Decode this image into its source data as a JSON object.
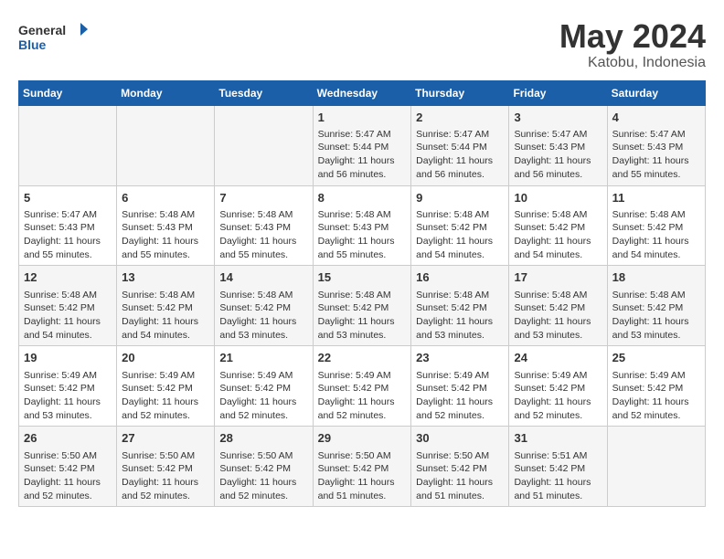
{
  "header": {
    "logo_line1": "General",
    "logo_line2": "Blue",
    "month": "May 2024",
    "location": "Katobu, Indonesia"
  },
  "weekdays": [
    "Sunday",
    "Monday",
    "Tuesday",
    "Wednesday",
    "Thursday",
    "Friday",
    "Saturday"
  ],
  "weeks": [
    [
      {
        "day": "",
        "info": ""
      },
      {
        "day": "",
        "info": ""
      },
      {
        "day": "",
        "info": ""
      },
      {
        "day": "1",
        "info": "Sunrise: 5:47 AM\nSunset: 5:44 PM\nDaylight: 11 hours and 56 minutes."
      },
      {
        "day": "2",
        "info": "Sunrise: 5:47 AM\nSunset: 5:44 PM\nDaylight: 11 hours and 56 minutes."
      },
      {
        "day": "3",
        "info": "Sunrise: 5:47 AM\nSunset: 5:43 PM\nDaylight: 11 hours and 56 minutes."
      },
      {
        "day": "4",
        "info": "Sunrise: 5:47 AM\nSunset: 5:43 PM\nDaylight: 11 hours and 55 minutes."
      }
    ],
    [
      {
        "day": "5",
        "info": "Sunrise: 5:47 AM\nSunset: 5:43 PM\nDaylight: 11 hours and 55 minutes."
      },
      {
        "day": "6",
        "info": "Sunrise: 5:48 AM\nSunset: 5:43 PM\nDaylight: 11 hours and 55 minutes."
      },
      {
        "day": "7",
        "info": "Sunrise: 5:48 AM\nSunset: 5:43 PM\nDaylight: 11 hours and 55 minutes."
      },
      {
        "day": "8",
        "info": "Sunrise: 5:48 AM\nSunset: 5:43 PM\nDaylight: 11 hours and 55 minutes."
      },
      {
        "day": "9",
        "info": "Sunrise: 5:48 AM\nSunset: 5:42 PM\nDaylight: 11 hours and 54 minutes."
      },
      {
        "day": "10",
        "info": "Sunrise: 5:48 AM\nSunset: 5:42 PM\nDaylight: 11 hours and 54 minutes."
      },
      {
        "day": "11",
        "info": "Sunrise: 5:48 AM\nSunset: 5:42 PM\nDaylight: 11 hours and 54 minutes."
      }
    ],
    [
      {
        "day": "12",
        "info": "Sunrise: 5:48 AM\nSunset: 5:42 PM\nDaylight: 11 hours and 54 minutes."
      },
      {
        "day": "13",
        "info": "Sunrise: 5:48 AM\nSunset: 5:42 PM\nDaylight: 11 hours and 54 minutes."
      },
      {
        "day": "14",
        "info": "Sunrise: 5:48 AM\nSunset: 5:42 PM\nDaylight: 11 hours and 53 minutes."
      },
      {
        "day": "15",
        "info": "Sunrise: 5:48 AM\nSunset: 5:42 PM\nDaylight: 11 hours and 53 minutes."
      },
      {
        "day": "16",
        "info": "Sunrise: 5:48 AM\nSunset: 5:42 PM\nDaylight: 11 hours and 53 minutes."
      },
      {
        "day": "17",
        "info": "Sunrise: 5:48 AM\nSunset: 5:42 PM\nDaylight: 11 hours and 53 minutes."
      },
      {
        "day": "18",
        "info": "Sunrise: 5:48 AM\nSunset: 5:42 PM\nDaylight: 11 hours and 53 minutes."
      }
    ],
    [
      {
        "day": "19",
        "info": "Sunrise: 5:49 AM\nSunset: 5:42 PM\nDaylight: 11 hours and 53 minutes."
      },
      {
        "day": "20",
        "info": "Sunrise: 5:49 AM\nSunset: 5:42 PM\nDaylight: 11 hours and 52 minutes."
      },
      {
        "day": "21",
        "info": "Sunrise: 5:49 AM\nSunset: 5:42 PM\nDaylight: 11 hours and 52 minutes."
      },
      {
        "day": "22",
        "info": "Sunrise: 5:49 AM\nSunset: 5:42 PM\nDaylight: 11 hours and 52 minutes."
      },
      {
        "day": "23",
        "info": "Sunrise: 5:49 AM\nSunset: 5:42 PM\nDaylight: 11 hours and 52 minutes."
      },
      {
        "day": "24",
        "info": "Sunrise: 5:49 AM\nSunset: 5:42 PM\nDaylight: 11 hours and 52 minutes."
      },
      {
        "day": "25",
        "info": "Sunrise: 5:49 AM\nSunset: 5:42 PM\nDaylight: 11 hours and 52 minutes."
      }
    ],
    [
      {
        "day": "26",
        "info": "Sunrise: 5:50 AM\nSunset: 5:42 PM\nDaylight: 11 hours and 52 minutes."
      },
      {
        "day": "27",
        "info": "Sunrise: 5:50 AM\nSunset: 5:42 PM\nDaylight: 11 hours and 52 minutes."
      },
      {
        "day": "28",
        "info": "Sunrise: 5:50 AM\nSunset: 5:42 PM\nDaylight: 11 hours and 52 minutes."
      },
      {
        "day": "29",
        "info": "Sunrise: 5:50 AM\nSunset: 5:42 PM\nDaylight: 11 hours and 51 minutes."
      },
      {
        "day": "30",
        "info": "Sunrise: 5:50 AM\nSunset: 5:42 PM\nDaylight: 11 hours and 51 minutes."
      },
      {
        "day": "31",
        "info": "Sunrise: 5:51 AM\nSunset: 5:42 PM\nDaylight: 11 hours and 51 minutes."
      },
      {
        "day": "",
        "info": ""
      }
    ]
  ]
}
